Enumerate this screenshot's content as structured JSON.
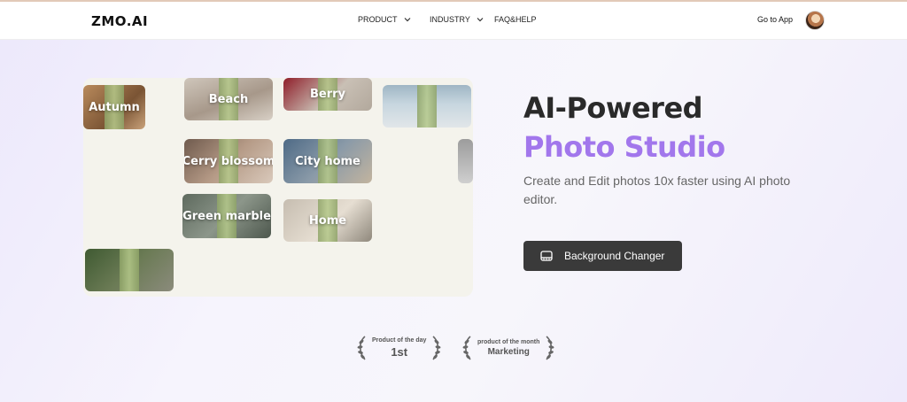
{
  "nav": {
    "logo": "ZMO.AI",
    "menu": [
      {
        "label": "PRODUCT"
      },
      {
        "label": "INDUSTRY"
      },
      {
        "label": "FAQ&HELP"
      }
    ],
    "go_to_app": "Go to App"
  },
  "gallery": {
    "tiles": [
      {
        "label": "Autumn"
      },
      {
        "label": "Beach"
      },
      {
        "label": "Berry"
      },
      {
        "label": ""
      },
      {
        "label": "Cerry blossom"
      },
      {
        "label": "City home"
      },
      {
        "label": "Green marble"
      },
      {
        "label": "Home"
      },
      {
        "label": ""
      },
      {
        "label": ""
      }
    ]
  },
  "hero": {
    "title_line1": "AI-Powered",
    "title_line2": "Photo Studio",
    "subtitle": "Create and Edit photos 10x faster using AI photo editor.",
    "cta_label": "Background Changer",
    "cta_icon": "image-frame-icon"
  },
  "awards": [
    {
      "top": "Product of the day",
      "bottom": "1st"
    },
    {
      "top": "product of the month",
      "bottom": "Marketing"
    }
  ],
  "colors": {
    "accent_purple": "#a277ec",
    "cta_bg": "#3a3a3a",
    "heading": "#2a2a2a"
  }
}
